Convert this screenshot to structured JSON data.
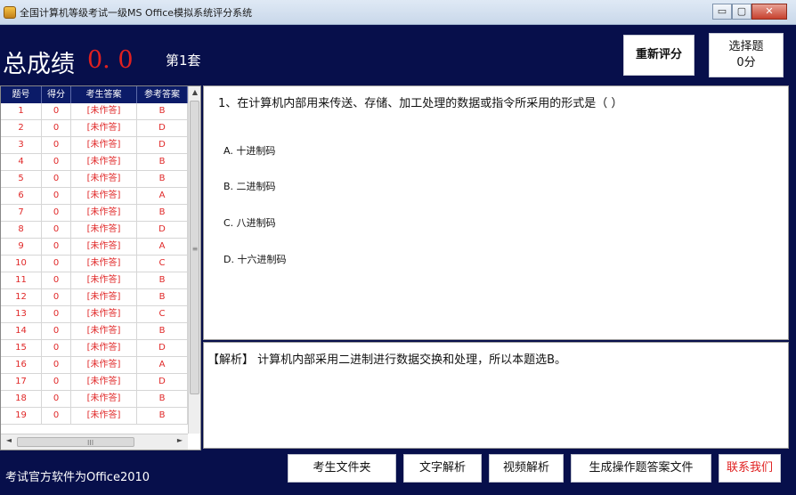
{
  "window": {
    "title": "全国计算机等级考试一级MS Office模拟系统评分系统",
    "btn_min": "▭",
    "btn_max": "▢",
    "btn_close": "✕"
  },
  "header": {
    "score_label": "总成绩",
    "score_value": "0. 0",
    "set_label": "第1套",
    "rescore_button": "重新评分",
    "choice_title": "选择题",
    "choice_score": "0分"
  },
  "table": {
    "columns": [
      "题号",
      "得分",
      "考生答案",
      "参考答案"
    ],
    "rows": [
      {
        "no": "1",
        "score": "0",
        "student": "[未作答]",
        "ref": "B"
      },
      {
        "no": "2",
        "score": "0",
        "student": "[未作答]",
        "ref": "D"
      },
      {
        "no": "3",
        "score": "0",
        "student": "[未作答]",
        "ref": "D"
      },
      {
        "no": "4",
        "score": "0",
        "student": "[未作答]",
        "ref": "B"
      },
      {
        "no": "5",
        "score": "0",
        "student": "[未作答]",
        "ref": "B"
      },
      {
        "no": "6",
        "score": "0",
        "student": "[未作答]",
        "ref": "A"
      },
      {
        "no": "7",
        "score": "0",
        "student": "[未作答]",
        "ref": "B"
      },
      {
        "no": "8",
        "score": "0",
        "student": "[未作答]",
        "ref": "D"
      },
      {
        "no": "9",
        "score": "0",
        "student": "[未作答]",
        "ref": "A"
      },
      {
        "no": "10",
        "score": "0",
        "student": "[未作答]",
        "ref": "C"
      },
      {
        "no": "11",
        "score": "0",
        "student": "[未作答]",
        "ref": "B"
      },
      {
        "no": "12",
        "score": "0",
        "student": "[未作答]",
        "ref": "B"
      },
      {
        "no": "13",
        "score": "0",
        "student": "[未作答]",
        "ref": "C"
      },
      {
        "no": "14",
        "score": "0",
        "student": "[未作答]",
        "ref": "B"
      },
      {
        "no": "15",
        "score": "0",
        "student": "[未作答]",
        "ref": "D"
      },
      {
        "no": "16",
        "score": "0",
        "student": "[未作答]",
        "ref": "A"
      },
      {
        "no": "17",
        "score": "0",
        "student": "[未作答]",
        "ref": "D"
      },
      {
        "no": "18",
        "score": "0",
        "student": "[未作答]",
        "ref": "B"
      },
      {
        "no": "19",
        "score": "0",
        "student": "[未作答]",
        "ref": "B"
      }
    ]
  },
  "question": {
    "text": "1、在计算机内部用来传送、存储、加工处理的数据或指令所采用的形式是（ ）",
    "options": [
      "A. 十进制码",
      "B. 二进制码",
      "C. 八进制码",
      "D. 十六进制码"
    ]
  },
  "analysis": {
    "text": "【解析】 计算机内部采用二进制进行数据交换和处理，所以本题选B。"
  },
  "footer": {
    "text": "考试官方软件为Office2010",
    "buttons": [
      "考生文件夹",
      "文字解析",
      "视频解析",
      "生成操作题答案文件",
      "联系我们"
    ]
  },
  "scrollbar": {
    "up_arrow": "▲",
    "left_arrow": "◄",
    "right_arrow": "►",
    "grip": "≡",
    "hgrip": "III"
  },
  "colors": {
    "app_background": "#070f4b",
    "table_header": "#0b1b68",
    "answer_text": "#e02828",
    "score_value": "#e02020"
  }
}
